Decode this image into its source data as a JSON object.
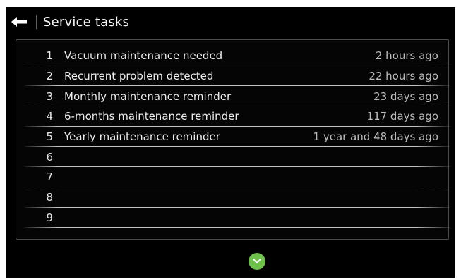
{
  "header": {
    "title": "Service tasks",
    "back_icon": "arrow-left-icon"
  },
  "tasks": [
    {
      "num": "1",
      "label": "Vacuum maintenance needed",
      "time": "2 hours ago"
    },
    {
      "num": "2",
      "label": "Recurrent problem detected",
      "time": "22 hours ago"
    },
    {
      "num": "3",
      "label": "Monthly maintenance reminder",
      "time": "23 days ago"
    },
    {
      "num": "4",
      "label": "6-months maintenance reminder",
      "time": "117 days ago"
    },
    {
      "num": "5",
      "label": "Yearly maintenance reminder",
      "time": "1 year and 48 days ago"
    },
    {
      "num": "6",
      "label": "",
      "time": ""
    },
    {
      "num": "7",
      "label": "",
      "time": ""
    },
    {
      "num": "8",
      "label": "",
      "time": ""
    },
    {
      "num": "9",
      "label": "",
      "time": ""
    }
  ],
  "footer": {
    "scroll_icon": "chevron-down-icon"
  },
  "colors": {
    "background": "#000000",
    "accent": "#6fc04a",
    "text": "#ececec",
    "muted_text": "#bdbdbd"
  }
}
